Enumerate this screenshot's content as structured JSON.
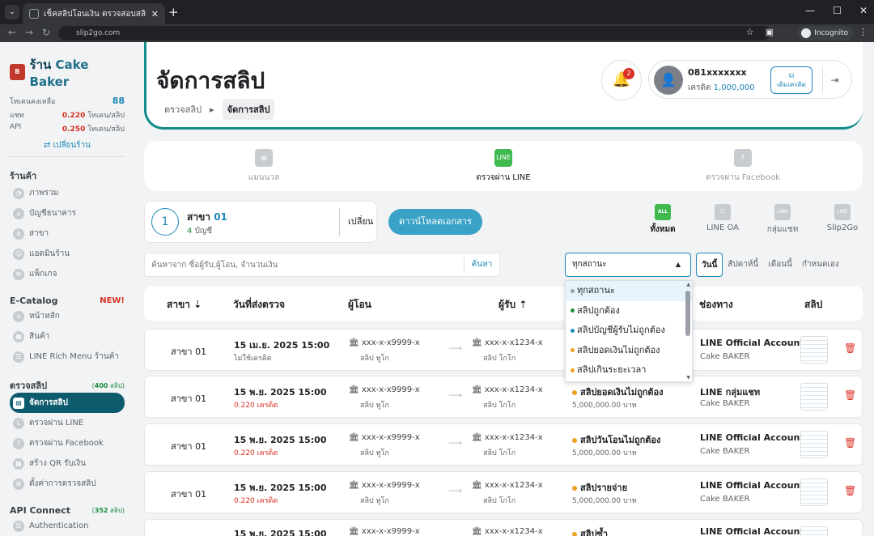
{
  "browser": {
    "tab_title": "เช็คสลิปโอนเงิน ตรวจสอบสลิปปลอม...",
    "url": "slip2go.com",
    "incognito_label": "Incognito"
  },
  "sidebar": {
    "shop_prefix": "ร้าน",
    "shop_name": "Cake Baker",
    "quota_label": "โทเคนคงเหลือ",
    "quota_value": "88",
    "chat_label": "แชท",
    "chat_value": "0.220",
    "chat_unit": "โทเคน/สลิป",
    "api_label": "API",
    "api_value": "0.250",
    "api_unit": "โทเคน/สลิป",
    "switch_label": "⇄ เปลี่ยนร้าน",
    "section_shop": "ร้านค้า",
    "shop_items": [
      {
        "label": "ภาพรวม"
      },
      {
        "label": "บัญชีธนาคาร"
      },
      {
        "label": "สาขา"
      },
      {
        "label": "แอดมินร้าน"
      },
      {
        "label": "แพ็กเกจ"
      }
    ],
    "section_catalog": "E-Catalog",
    "catalog_badge": "NEW!",
    "catalog_items": [
      {
        "label": "หน้าหลัก"
      },
      {
        "label": "สินค้า"
      },
      {
        "label": "LINE Rich Menu ร้านค้า"
      }
    ],
    "section_slip": "ตรวจสลิป",
    "slip_count_value": "400",
    "slip_count_unit": "สลิป",
    "slip_items": [
      {
        "label": "จัดการสลิป"
      },
      {
        "label": "ตรวจผ่าน LINE"
      },
      {
        "label": "ตรวจผ่าน Facebook"
      },
      {
        "label": "สร้าง QR รับเงิน"
      },
      {
        "label": "ตั้งค่าการตรวจสลิป"
      }
    ],
    "section_api": "API Connect",
    "api_count_value": "352",
    "api_count_unit": "สลิป",
    "api_items": [
      {
        "label": "Authentication"
      }
    ]
  },
  "header": {
    "title": "จัดการสลิป",
    "breadcrumb_root": "ตรวจสลิป",
    "breadcrumb_current": "จัดการสลิป",
    "notifications": "2",
    "user_phone": "081xxxxxxx",
    "credit_label": "เครดิต",
    "credit_value": "1,000,000",
    "topup_label": "เติมเครดิต"
  },
  "modes": [
    {
      "label": "แมนนวล"
    },
    {
      "label": "ตรวจผ่าน LINE",
      "icon_text": "LINE"
    },
    {
      "label": "ตรวจผ่าน Facebook"
    }
  ],
  "branch": {
    "number": "1",
    "title_prefix": "สาขา",
    "title_value": "01",
    "accounts_value": "4",
    "accounts_unit": "บัญชี",
    "change_label": "เปลี่ยน"
  },
  "download_label": "ดาวน์โหลดเอกสาร",
  "channels": [
    {
      "label": "ทั้งหมด",
      "icon_text": "ALL"
    },
    {
      "label": "LINE OA",
      "icon_text": ""
    },
    {
      "label": "กลุ่มแชท",
      "icon_text": "LINE กลุ่ม"
    },
    {
      "label": "Slip2Go",
      "icon_text": "LINE"
    }
  ],
  "search": {
    "placeholder": "ค้นหาจาก ชื่อผู้รับ,ผู้โอน, จำนวนเงิน",
    "button": "ค้นหา"
  },
  "status_select": {
    "selected": "ทุกสถานะ",
    "options": [
      {
        "label": "ทุกสถานะ",
        "color": "#9aa0a6"
      },
      {
        "label": "สลิปถูกต้อง",
        "color": "#1e8e3e"
      },
      {
        "label": "สลิปบัญชีผู้รับไม่ถูกต้อง",
        "color": "#1e88b8"
      },
      {
        "label": "สลิปยอดเงินไม่ถูกต้อง",
        "color": "#f0a020"
      },
      {
        "label": "สลิปเกินระยะเวลา",
        "color": "#f0a020"
      }
    ]
  },
  "ranges": [
    "วันนี้",
    "สัปดาห์นี้",
    "เดือนนี้",
    "กำหนดเอง"
  ],
  "table": {
    "headers": [
      "สาขา ⇣",
      "วันที่ส่งตรวจ",
      "ผู้โอน",
      "ผู้รับ ⇡",
      "ช่องทาง",
      "สลิป"
    ],
    "rows": [
      {
        "branch": "สาขา 01",
        "date": "15 เม.ย. 2025 15:00",
        "credit": "ไม่ใช้เครดิต",
        "from": "🏛 xxx-x-x9999-x",
        "from_bank": "สลิป ทูโก",
        "to": "🏛 xxx-x-x1234-x",
        "to_bank": "สลิป โกโก",
        "status": "",
        "amount": "",
        "channel": "LINE Official Account",
        "channel_sub": "Cake BAKER"
      },
      {
        "branch": "สาขา 01",
        "date": "15 พ.ย. 2025 15:00",
        "credit": "0.220 เครดิต",
        "from": "🏛 xxx-x-x9999-x",
        "from_bank": "สลิป ทูโก",
        "to": "🏛 xxx-x-x1234-x",
        "to_bank": "สลิป โกโก",
        "status": "สลิปยอดเงินไม่ถูกต้อง",
        "amount": "5,000,000.00 บาท",
        "channel": "LINE กลุ่มแชท",
        "channel_sub": "Cake BAKER"
      },
      {
        "branch": "สาขา 01",
        "date": "15 พ.ย. 2025 15:00",
        "credit": "0.220 เครดิต",
        "from": "🏛 xxx-x-x9999-x",
        "from_bank": "สลิป ทูโก",
        "to": "🏛 xxx-x-x1234-x",
        "to_bank": "สลิป โกโก",
        "status": "สลิปวันโอนไม่ถูกต้อง",
        "amount": "5,000,000.00 บาท",
        "channel": "LINE Official Account",
        "channel_sub": "Cake BAKER"
      },
      {
        "branch": "สาขา 01",
        "date": "15 พ.ย. 2025 15:00",
        "credit": "0.220 เครดิต",
        "from": "🏛 xxx-x-x9999-x",
        "from_bank": "สลิป ทูโก",
        "to": "🏛 xxx-x-x1234-x",
        "to_bank": "สลิป โกโก",
        "status": "สลิปรายจ่าย",
        "amount": "5,000,000.00 บาท",
        "channel": "LINE Official Account",
        "channel_sub": "Cake BAKER"
      },
      {
        "branch": "",
        "date": "15 พ.ย. 2025 15:00",
        "credit": "",
        "from": "🏛 xxx-x-x9999-x",
        "from_bank": "",
        "to": "🏛 xxx-x-x1234-x",
        "to_bank": "",
        "status": "สลิปซ้ำ",
        "amount": "",
        "channel": "LINE Official Account",
        "channel_sub": ""
      }
    ]
  }
}
